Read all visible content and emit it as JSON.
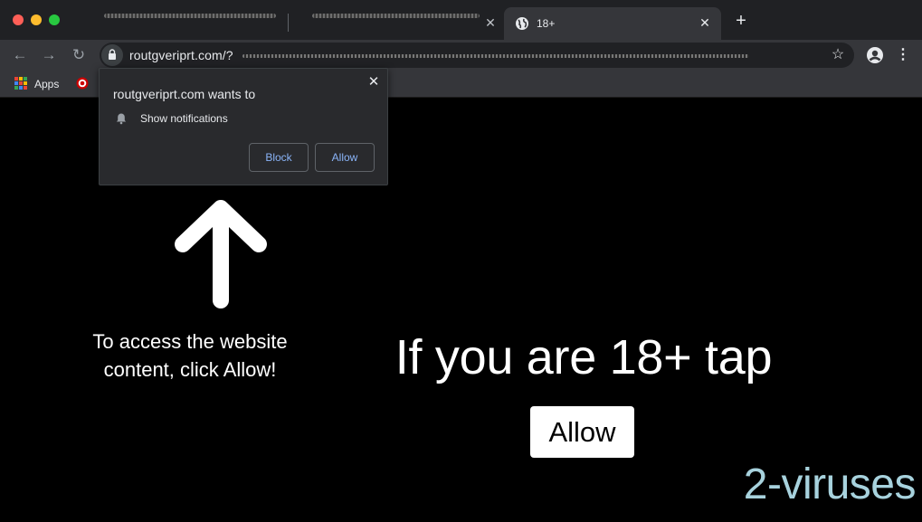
{
  "browser": {
    "active_tab": {
      "title": "18+",
      "icon": "globe-icon"
    },
    "address_bar": {
      "url": "routgveriprt.com/?"
    },
    "bookmarks": {
      "apps_label": "Apps"
    },
    "icons": {
      "back": "back-arrow-icon",
      "forward": "forward-arrow-icon",
      "reload": "reload-icon",
      "lock": "lock-icon",
      "star": "star-icon",
      "profile": "profile-icon",
      "menu": "kebab-menu-icon"
    },
    "colors": {
      "tab_bar": "#202124",
      "toolbar": "#35363a",
      "accent_link": "#8ab4f8"
    }
  },
  "notification_prompt": {
    "title": "routgveriprt.com wants to",
    "permission": "Show notifications",
    "block_label": "Block",
    "allow_label": "Allow"
  },
  "page": {
    "hint_line1": "To access the website",
    "hint_line2": "content, click Allow!",
    "headline": "If you are 18+ tap",
    "allow_button": "Allow",
    "watermark": "2-viruses",
    "watermark_color": "#a7d2dd"
  }
}
